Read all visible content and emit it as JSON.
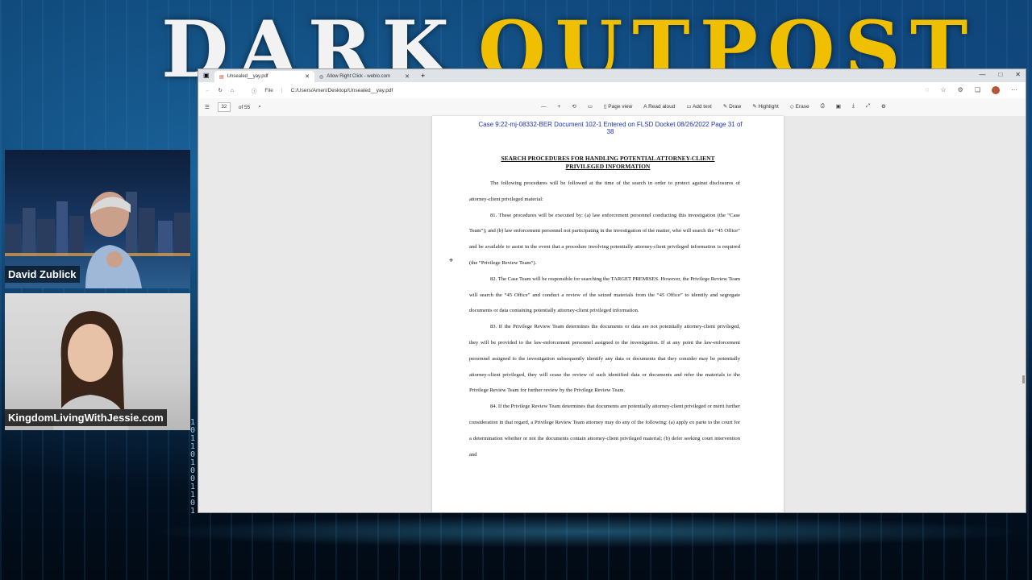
{
  "overlay": {
    "logo_word1": "DARK",
    "logo_word2": "OUTPOST",
    "binary": "1\n0\n1\n1\n0\n1\n0\n0\n1\n1\n0\n1",
    "host1_name": "David Zublick",
    "host2_name": "KingdomLivingWithJessie.com"
  },
  "browser": {
    "tabs": [
      {
        "label": "Unsealed__yay.pdf",
        "active": true
      },
      {
        "label": "Allow Right Click - weblo.com",
        "active": false
      }
    ],
    "new_tab": "+",
    "window_controls": [
      "—",
      "□",
      "✕"
    ],
    "address": {
      "file_label": "File",
      "url": "C:/Users/Ameri/Desktop/Unsealed__yay.pdf"
    },
    "pdf_toolbar": {
      "page_number": "32",
      "page_total": "of 55",
      "zoom_out": "—",
      "zoom_in": "+",
      "page_view": "Page view",
      "read_aloud": "Read aloud",
      "add_text": "Add text",
      "draw": "Draw",
      "highlight": "Highlight",
      "erase": "Erase"
    }
  },
  "document": {
    "header_line1": "Case 9:22-mj-08332-BER   Document 102-1   Entered on FLSD Docket 08/26/2022   Page 31 of",
    "header_line2": "38",
    "title_line1": "SEARCH PROCEDURES FOR HANDLING POTENTIAL ATTORNEY-CLIENT",
    "title_line2": "PRIVILEGED INFORMATION",
    "paragraphs": [
      "The following procedures will be followed at the time of the search in order to protect against disclosures of attorney-client privileged material:",
      "81.     These procedures will be executed by: (a) law enforcement personnel conducting this investigation (the “Case Team”); and (b) law enforcement personnel not participating in the investigation of the matter, who will search the “45 Office” and be available to assist in the event that a procedure involving potentially attorney-client privileged information is required (the “Privilege Review Team”).",
      "82.     The Case Team will be responsible for searching the TARGET PREMISES. However, the Privilege Review Team will search the “45 Office” and conduct a review of the seized materials from the “45 Office” to identify and segregate documents or data containing potentially attorney-client privileged information.",
      "83.     If the Privilege Review Team determines the documents or data are not potentially attorney-client privileged, they will be provided to the law-enforcement personnel assigned to the investigation.  If at any point the law-enforcement personnel assigned to the investigation subsequently identify any data or documents that they consider may be potentially attorney-client privileged, they will cease the review of such identified data or documents and refer the materials to the Privilege Review Team for further review by the Privilege Review Team.",
      "84.     If the Privilege Review Team determines that documents are potentially attorney-client privileged or merit further consideration in that regard, a Privilege Review Team attorney may do any of the following: (a) apply ex parte to the court for a determination whether or not the documents contain attorney-client privileged material; (b) defer seeking court intervention and"
    ]
  }
}
